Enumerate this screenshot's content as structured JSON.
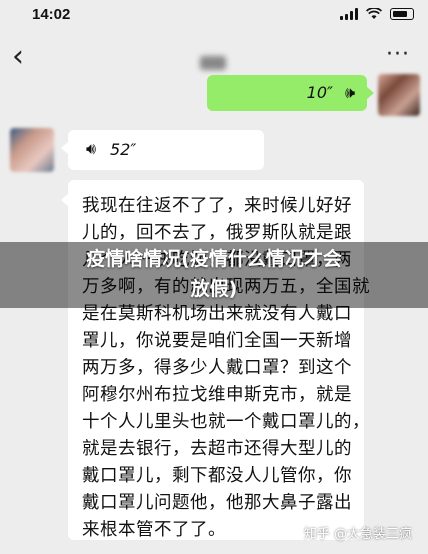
{
  "status_bar": {
    "time": "14:02"
  },
  "nav": {
    "back_icon": "chevron-left-icon",
    "more_icon": "more-dots-icon",
    "back_glyph": "‹",
    "more_glyph": "···"
  },
  "messages": {
    "outgoing_voice": {
      "duration": "10″",
      "icon": "voice-wave-icon"
    },
    "incoming_voice": {
      "duration": "52″",
      "icon": "voice-wave-icon"
    },
    "incoming_text": {
      "lines": [
        "我现在往返不了了，来时候儿好好",
        "儿的，回不去了，俄罗斯队就是跟",
        "几个人一块吃饭，都没戴口罩，两",
        "万多啊，有的就出现两万五，全国就",
        "是在莫斯科机场出来就没有人戴口",
        "罩儿，你说要是咱们全国一天新增",
        "两万多，得多少人戴口罩？到这个",
        "阿穆尔州布拉戈维申斯克市，就是",
        "十个人儿里头也就一个戴口罩儿的，",
        "就是去银行，去超市还得大型儿的",
        "戴口罩儿，剩下都没人儿管你，你",
        "戴口罩儿问题他，他那大鼻子露出",
        "来根本管不了了。"
      ]
    }
  },
  "overlay": {
    "title_line1": "疫情啥情况(疫情什么情况才会",
    "title_line2": "放假)"
  },
  "watermark": "知乎 @太急装三疯"
}
